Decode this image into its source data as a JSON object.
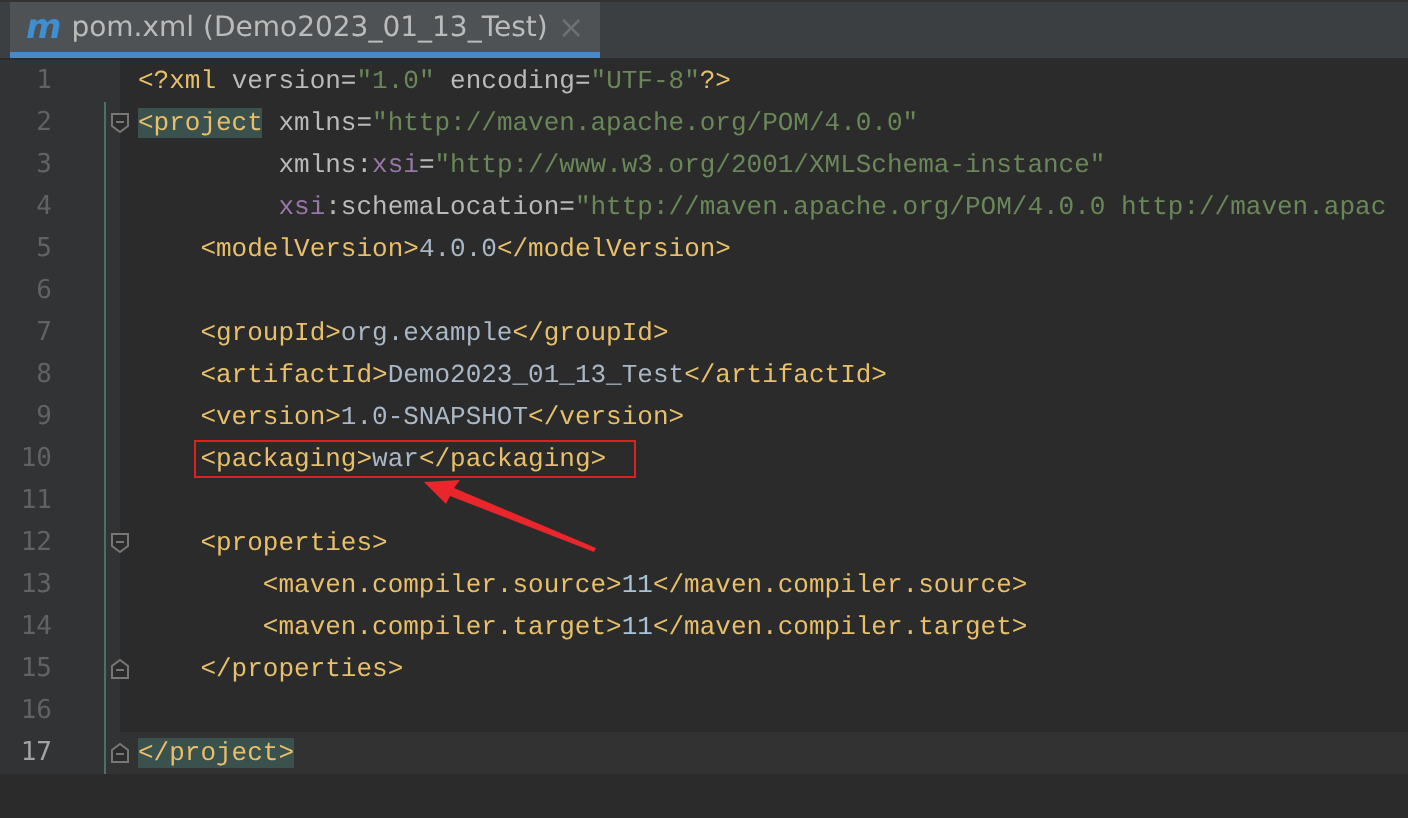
{
  "tab": {
    "icon_letter": "m",
    "title": "pom.xml (Demo2023_01_13_Test)",
    "close": "×",
    "selected": true
  },
  "lines": [
    {
      "number": "1",
      "tokens": [
        {
          "kind": "tag",
          "text": "<?xml"
        },
        {
          "kind": "attr",
          "text": " version="
        },
        {
          "kind": "value",
          "text": "\"1.0\""
        },
        {
          "kind": "attr",
          "text": " encoding="
        },
        {
          "kind": "value",
          "text": "\"UTF-8\""
        },
        {
          "kind": "tag",
          "text": "?>"
        }
      ]
    },
    {
      "number": "2",
      "fold_start": true,
      "tokens": [
        {
          "kind": "tag",
          "text": "<project",
          "matched": true
        },
        {
          "kind": "attr",
          "text": " xmlns="
        },
        {
          "kind": "value",
          "text": "\"http://maven.apache.org/POM/4.0.0\""
        }
      ]
    },
    {
      "number": "3",
      "tokens": [
        {
          "kind": "attr",
          "text": "         xmlns:"
        },
        {
          "kind": "ns",
          "text": "xsi"
        },
        {
          "kind": "attr",
          "text": "="
        },
        {
          "kind": "value",
          "text": "\"http://www.w3.org/2001/XMLSchema-instance\""
        }
      ]
    },
    {
      "number": "4",
      "tokens": [
        {
          "kind": "ns",
          "text": "         xsi"
        },
        {
          "kind": "attr",
          "text": ":schemaLocation="
        },
        {
          "kind": "value",
          "text": "\"http://maven.apache.org/POM/4.0.0 http://maven.apac"
        }
      ]
    },
    {
      "number": "5",
      "tokens": [
        {
          "kind": "tag",
          "text": "    <modelVersion>"
        },
        {
          "kind": "text",
          "text": "4.0.0"
        },
        {
          "kind": "tag",
          "text": "</modelVersion>"
        }
      ]
    },
    {
      "number": "6"
    },
    {
      "number": "7",
      "tokens": [
        {
          "kind": "tag",
          "text": "    <groupId>"
        },
        {
          "kind": "text",
          "text": "org.example"
        },
        {
          "kind": "tag",
          "text": "</groupId>"
        }
      ]
    },
    {
      "number": "8",
      "tokens": [
        {
          "kind": "tag",
          "text": "    <artifactId>"
        },
        {
          "kind": "text",
          "text": "Demo2023_01_13_Test"
        },
        {
          "kind": "tag",
          "text": "</artifactId>"
        }
      ]
    },
    {
      "number": "9",
      "tokens": [
        {
          "kind": "tag",
          "text": "    <version>"
        },
        {
          "kind": "text",
          "text": "1.0-SNAPSHOT"
        },
        {
          "kind": "tag",
          "text": "</version>"
        }
      ]
    },
    {
      "number": "10",
      "boxed": true,
      "tokens": [
        {
          "kind": "tag",
          "text": "    <packaging>"
        },
        {
          "kind": "text",
          "text": "war"
        },
        {
          "kind": "tag",
          "text": "</packaging>"
        }
      ]
    },
    {
      "number": "11"
    },
    {
      "number": "12",
      "fold_start": true,
      "tokens": [
        {
          "kind": "tag",
          "text": "    <properties>"
        }
      ]
    },
    {
      "number": "13",
      "tokens": [
        {
          "kind": "tag",
          "text": "        <maven.compiler.source>"
        },
        {
          "kind": "number",
          "text": "11"
        },
        {
          "kind": "tag",
          "text": "</maven.compiler.source>"
        }
      ]
    },
    {
      "number": "14",
      "tokens": [
        {
          "kind": "tag",
          "text": "        <maven.compiler.target>"
        },
        {
          "kind": "number",
          "text": "11"
        },
        {
          "kind": "tag",
          "text": "</maven.compiler.target>"
        }
      ]
    },
    {
      "number": "15",
      "fold_end": true,
      "tokens": [
        {
          "kind": "tag",
          "text": "    </properties>"
        }
      ]
    },
    {
      "number": "16"
    },
    {
      "number": "17",
      "fold_end": true,
      "current": true,
      "tokens": [
        {
          "kind": "tag",
          "text": "</project>",
          "matched": true
        }
      ]
    }
  ]
}
